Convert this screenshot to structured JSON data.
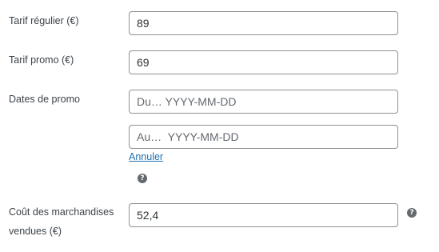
{
  "regular_price": {
    "label": "Tarif régulier (€)",
    "value": "89"
  },
  "sale_price": {
    "label": "Tarif promo (€)",
    "value": "69"
  },
  "sale_dates": {
    "label": "Dates de promo",
    "from_placeholder": "Du… YYYY-MM-DD",
    "to_placeholder": "Au…  YYYY-MM-DD",
    "cancel_link": "Annuler",
    "help_icon": "question-mark-icon"
  },
  "cost_of_goods": {
    "label_line1": "Coût des marchandises",
    "label_line2": "vendues (€)",
    "value": "52,4",
    "help_icon": "question-mark-icon"
  },
  "colors": {
    "link": "#2271b1",
    "border": "#8c8f94",
    "text": "#3c434a",
    "help_icon": "#646970"
  }
}
